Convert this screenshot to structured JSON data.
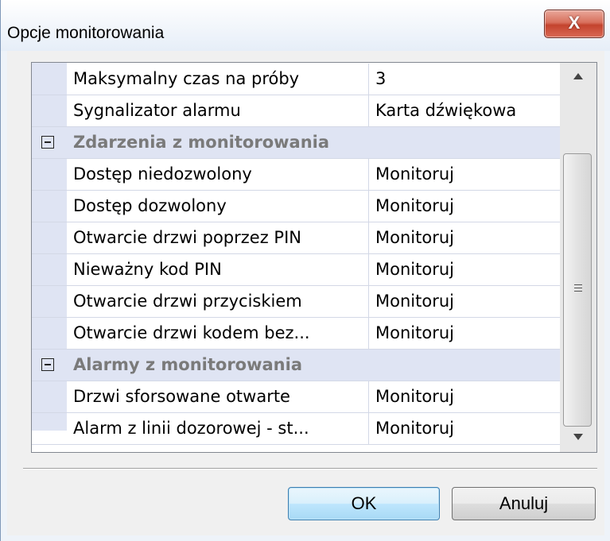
{
  "window": {
    "title": "Opcje monitorowania",
    "close_symbol": "X"
  },
  "properties": {
    "rows": [
      {
        "type": "property",
        "name": "Maksymalny czas na próby",
        "value": "3"
      },
      {
        "type": "property",
        "name": "Sygnalizator alarmu",
        "value": "Karta dźwiękowa"
      },
      {
        "type": "category",
        "name": "Zdarzenia z monitorowania",
        "expanded": true
      },
      {
        "type": "property",
        "name": "Dostęp niedozwolony",
        "value": "Monitoruj"
      },
      {
        "type": "property",
        "name": "Dostęp dozwolony",
        "value": "Monitoruj"
      },
      {
        "type": "property",
        "name": "Otwarcie drzwi poprzez PIN",
        "value": "Monitoruj"
      },
      {
        "type": "property",
        "name": "Nieważny kod PIN",
        "value": "Monitoruj"
      },
      {
        "type": "property",
        "name": "Otwarcie drzwi przyciskiem",
        "value": "Monitoruj"
      },
      {
        "type": "property",
        "name": "Otwarcie drzwi kodem bez...",
        "value": "Monitoruj"
      },
      {
        "type": "category",
        "name": "Alarmy z monitorowania",
        "expanded": true
      },
      {
        "type": "property",
        "name": "Drzwi sforsowane otwarte",
        "value": "Monitoruj"
      },
      {
        "type": "property",
        "name": "Alarm z linii dozorowej - st...",
        "value": "Monitoruj"
      }
    ]
  },
  "buttons": {
    "ok_label": "OK",
    "cancel_label": "Anuluj"
  },
  "colors": {
    "category_background": "#dfe4f3",
    "category_text": "#7a7a7a",
    "close_button": "#c4432e"
  },
  "icons": {
    "close": "close-icon",
    "collapse": "minus-box-icon",
    "scroll_up": "triangle-up-icon",
    "scroll_down": "triangle-down-icon",
    "scroll_grip": "grip-lines-icon"
  }
}
